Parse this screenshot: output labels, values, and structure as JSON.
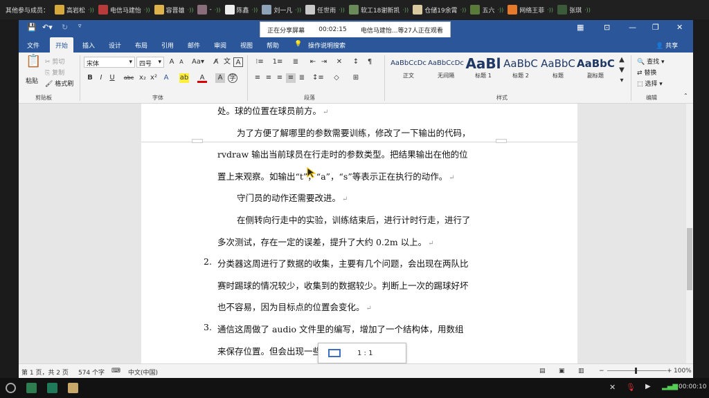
{
  "topbar": {
    "label": "其他参与成员：",
    "members": [
      {
        "name": "高岩松",
        "color": "#d7a93a"
      },
      {
        "name": "电信马建怡",
        "color": "#b73b3b"
      },
      {
        "name": "容晋雄",
        "color": "#e0b34a"
      },
      {
        "name": "-",
        "color": "#8a6d7a"
      },
      {
        "name": "陈鑫",
        "color": "#eeeeee"
      },
      {
        "name": "刘一凡",
        "color": "#8fa3b8"
      },
      {
        "name": "任世雨",
        "color": "#c9c9c9"
      },
      {
        "name": "软工18谢新凯",
        "color": "#6a8a5a"
      },
      {
        "name": "仓储19余霄",
        "color": "#d8c9a0"
      },
      {
        "name": "五六",
        "color": "#5a7a3a"
      },
      {
        "name": "网络王菲",
        "color": "#e67a2a"
      },
      {
        "name": "张琪",
        "color": "#3a5a3a"
      }
    ]
  },
  "share": {
    "status": "正在分享屏幕",
    "time": "00:02:15",
    "viewers": "电信马建怡...等27人正在观看"
  },
  "tabs": [
    "文件",
    "开始",
    "插入",
    "设计",
    "布局",
    "引用",
    "邮件",
    "审阅",
    "视图",
    "帮助",
    "操作说明搜索"
  ],
  "share_button": "共享",
  "ribbon": {
    "clipboard": {
      "paste": "粘贴",
      "cut": "剪切",
      "copy": "复制",
      "format_painter": "格式刷",
      "group": "剪贴板"
    },
    "font": {
      "name": "宋体",
      "size": "四号",
      "group": "字体"
    },
    "paragraph": {
      "group": "段落"
    },
    "styles": {
      "group": "样式",
      "items": [
        {
          "preview": "AaBbCcDc",
          "name": "正文"
        },
        {
          "preview": "AaBbCcDc",
          "name": "无间隔"
        },
        {
          "preview": "AaBl",
          "name": "标题 1"
        },
        {
          "preview": "AaBbC",
          "name": "标题 2"
        },
        {
          "preview": "AaBbC",
          "name": "标题"
        },
        {
          "preview": "AaBbC",
          "name": "副标题"
        }
      ]
    },
    "editing": {
      "find": "查找",
      "replace": "替换",
      "select": "选择",
      "group": "编辑"
    }
  },
  "document": {
    "lines": [
      "处。球的位置在球员前方。",
      "为了方便了解哪里的参数需要训练，修改了一下输出的代码，",
      "rvdraw 输出当前球员在行走时的参数类型。把结果输出在他的位",
      "置上来观察。如输出“t”，“a”，“s”等表示正在执行的动作。",
      "守门员的动作还需要改进。",
      "在侧转向行走中的实验，训练结束后，进行计时行走，进行了",
      "多次测试，存在一定的误差，提升了大约 0.2m 以上。",
      "分类器这周进行了数据的收集，主要有几个问题，会出现在两队比",
      "赛时踢球的情况较少，收集到的数据较少。判断上一次的踢球好坏",
      "也不容易，因为目标点的位置会变化。",
      "通信这周做了 audio 文件里的编写，增加了一个结构体，用数组",
      "来保存位置。但会出现一些问题，还在修改中。"
    ],
    "numbers": [
      "2.",
      "3."
    ],
    "zoom_ratio": "1 : 1"
  },
  "status": {
    "page": "第 1 页，共 2 页",
    "words": "574 个字",
    "lang": "中文(中国)",
    "zoom": "100%"
  },
  "taskbar": {
    "time": "00:00:10"
  },
  "colors": {
    "word_blue": "#2b579a",
    "ribbon_bg": "#f3f3f3"
  }
}
